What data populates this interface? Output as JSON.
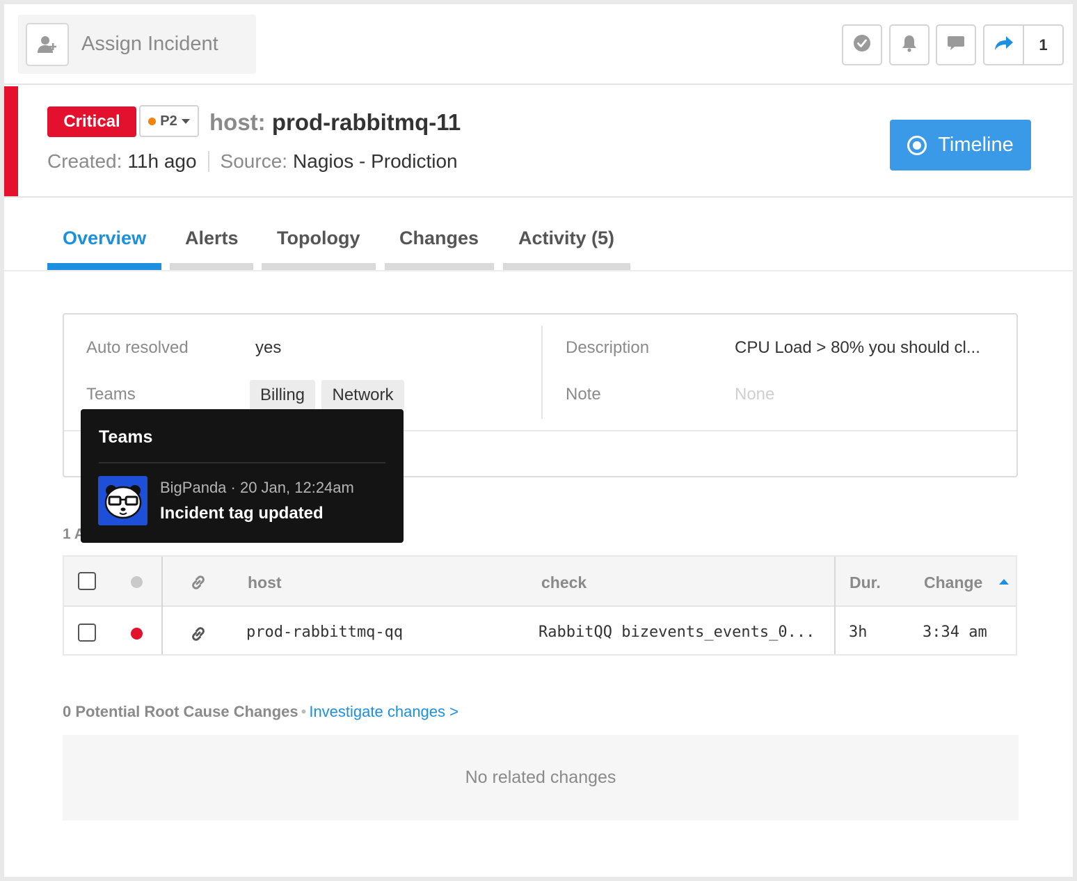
{
  "topbar": {
    "assign_label": "Assign Incident",
    "assign_icon": "add-user-icon",
    "actions": [
      "resolve-icon",
      "bell-icon",
      "comment-icon",
      "share-icon"
    ],
    "share_count": "1"
  },
  "incident": {
    "severity": "Critical",
    "severity_color": "#e3112d",
    "priority": "P2",
    "priority_color": "#f5820b",
    "host_label": "host:",
    "host_value": "prod-rabbitmq-11",
    "created_label": "Created:",
    "created_value": "11h ago",
    "source_label": "Source:",
    "source_value": "Nagios - Prodiction",
    "timeline_label": "Timeline"
  },
  "tabs": [
    {
      "label": "Overview",
      "active": true
    },
    {
      "label": "Alerts"
    },
    {
      "label": "Topology"
    },
    {
      "label": "Changes"
    },
    {
      "label": "Activity (5)"
    }
  ],
  "overview": {
    "auto_resolved_label": "Auto resolved",
    "auto_resolved_value": "yes",
    "teams_label": "Teams",
    "teams": [
      "Billing",
      "Network"
    ],
    "description_label": "Description",
    "description_value": "CPU Load > 80% you should cl...",
    "note_label": "Note",
    "note_value": "None"
  },
  "tooltip": {
    "title": "Teams",
    "meta": "BigPanda · 20 Jan, 12:24am",
    "event": "Incident tag updated"
  },
  "alerts": {
    "count_text": "1 A",
    "columns": {
      "host": "host",
      "check": "check",
      "duration": "Dur.",
      "change": "Change"
    },
    "rows": [
      {
        "status_color": "#e3112d",
        "host": "prod-rabbittmq-qq",
        "check": "RabbitQQ bizevents_events_0...",
        "duration": "3h",
        "change": "3:34 am"
      }
    ]
  },
  "changes": {
    "count_text": "0 Potential Root Cause Changes",
    "bullet": "•",
    "link": "Investigate changes >",
    "empty_text": "No related changes"
  },
  "colors": {
    "accent": "#1c8fe0",
    "timeline_button": "#3b9ae8"
  }
}
